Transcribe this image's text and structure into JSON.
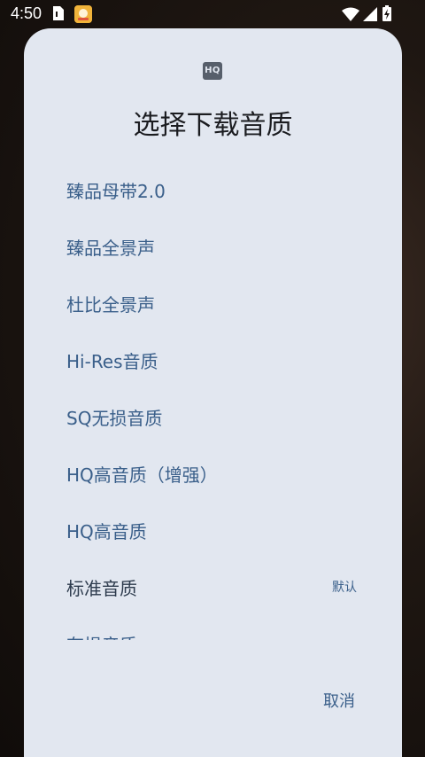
{
  "status_bar": {
    "time": "4:50"
  },
  "dialog": {
    "icon_text": "HQ",
    "title": "选择下载音质",
    "options": [
      {
        "label": "臻品母带2.0",
        "tag": ""
      },
      {
        "label": "臻品全景声",
        "tag": ""
      },
      {
        "label": "杜比全景声",
        "tag": ""
      },
      {
        "label": "Hi-Res音质",
        "tag": ""
      },
      {
        "label": "SQ无损音质",
        "tag": ""
      },
      {
        "label": "HQ高音质（增强）",
        "tag": ""
      },
      {
        "label": "HQ高音质",
        "tag": ""
      },
      {
        "label": "标准音质",
        "tag": "默认"
      },
      {
        "label": "有损音质",
        "tag": ""
      }
    ],
    "cancel_label": "取消"
  }
}
